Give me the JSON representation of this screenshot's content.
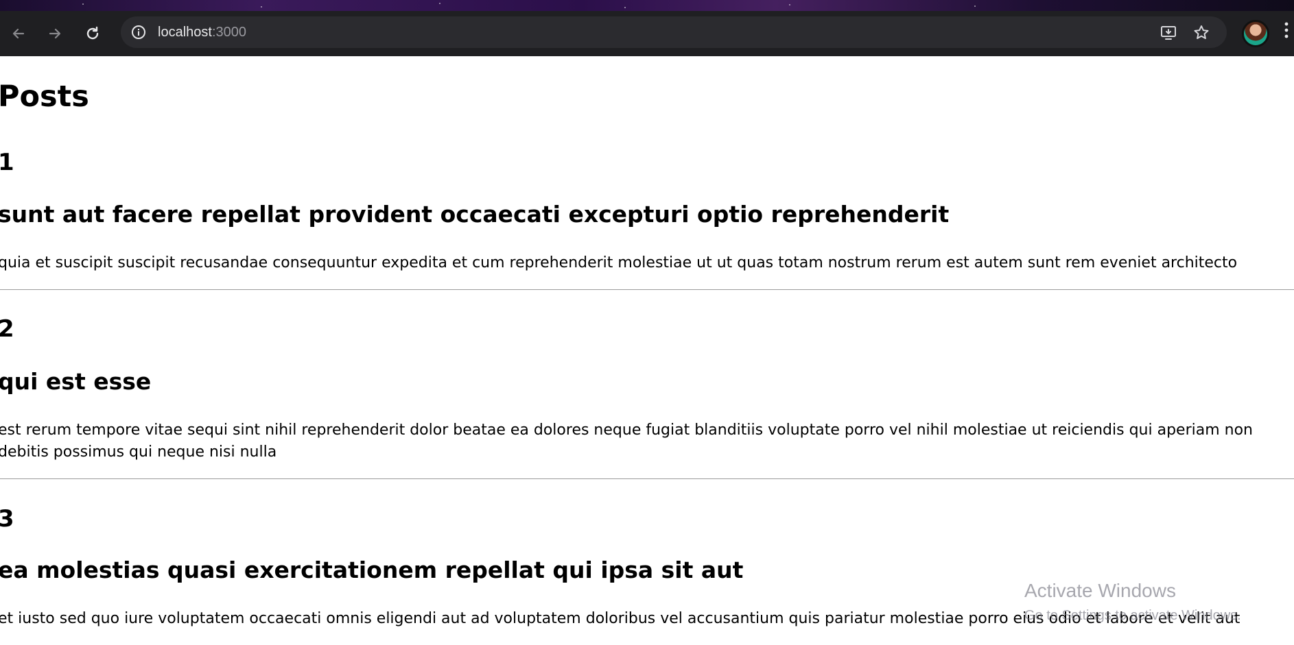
{
  "browser": {
    "url_host": "localhost",
    "url_port": ":3000",
    "icons": [
      "back-icon",
      "forward-icon",
      "reload-icon",
      "site-info-icon",
      "install-app-icon",
      "bookmark-star-icon",
      "profile-avatar",
      "menu-icon"
    ]
  },
  "page": {
    "heading": "Posts",
    "posts": [
      {
        "id": "1",
        "title": "sunt aut facere repellat provident occaecati excepturi optio reprehenderit",
        "body": "quia et suscipit suscipit recusandae consequuntur expedita et cum reprehenderit molestiae ut ut quas totam nostrum rerum est autem sunt rem eveniet architecto"
      },
      {
        "id": "2",
        "title": "qui est esse",
        "body": "est rerum tempore vitae sequi sint nihil reprehenderit dolor beatae ea dolores neque fugiat blanditiis voluptate porro vel nihil molestiae ut reiciendis qui aperiam non debitis possimus qui neque nisi nulla"
      },
      {
        "id": "3",
        "title": "ea molestias quasi exercitationem repellat qui ipsa sit aut",
        "body": "et iusto sed quo iure voluptatem occaecati omnis eligendi aut ad voluptatem doloribus vel accusantium quis pariatur molestiae porro eius odio et labore et velit aut"
      }
    ]
  },
  "os_overlay": {
    "watermark_title": "Activate Windows",
    "watermark_subtitle": "Go to Settings to activate Windows."
  },
  "colors": {
    "toolbar_bg": "#1f1f22",
    "omnibox_bg": "#2b2b2f",
    "page_bg": "#ffffff",
    "divider": "#9a9a9a"
  }
}
